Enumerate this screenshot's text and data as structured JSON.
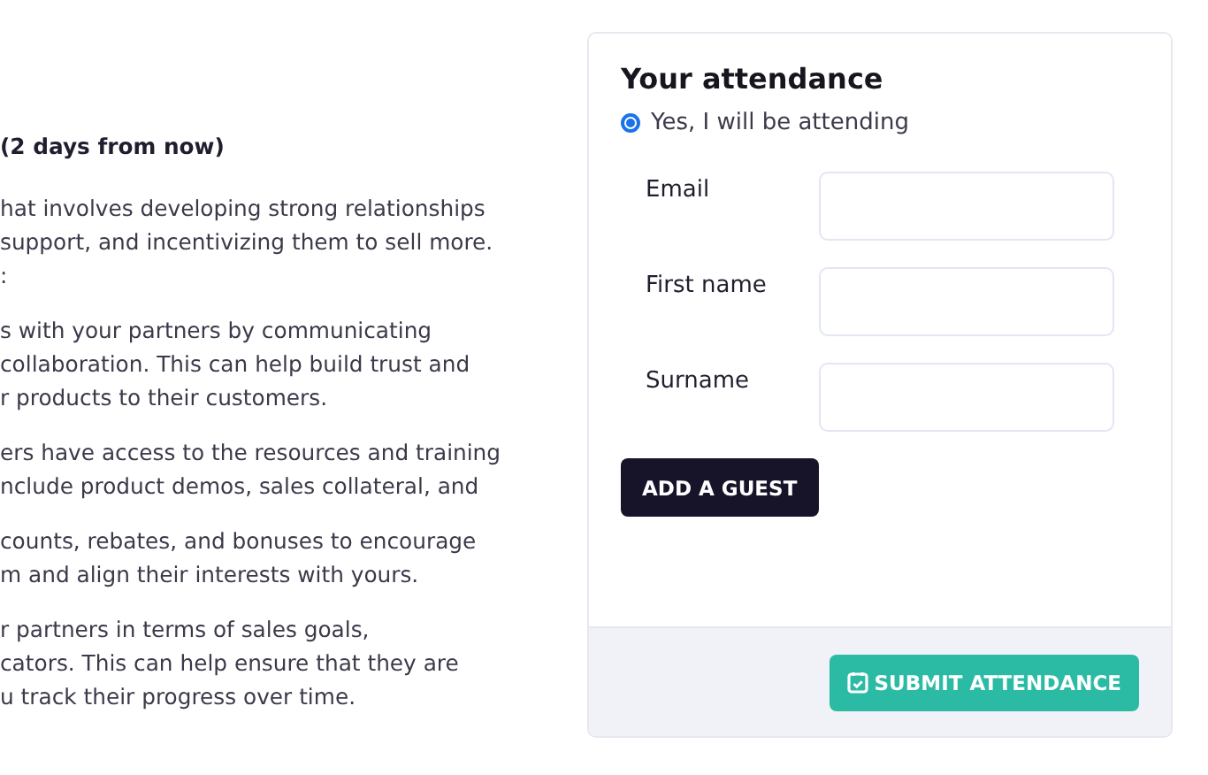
{
  "article": {
    "heading": "(2 days from now)",
    "paragraphs": [
      [
        "hat involves developing strong relationships",
        "support, and incentivizing them to sell more.",
        ":"
      ],
      [
        "s with your partners by communicating",
        "collaboration. This can help build trust and",
        "r products to their customers."
      ],
      [
        "ers have access to the resources and training",
        "nclude product demos, sales collateral, and"
      ],
      [
        "counts, rebates, and bonuses to encourage",
        "m and align their interests with yours."
      ],
      [
        "r partners in terms of sales goals,",
        "cators. This can help ensure that they are",
        "u track their progress over time."
      ]
    ]
  },
  "attendance": {
    "title": "Your attendance",
    "option": {
      "label": "Yes, I will be attending",
      "selected": true
    },
    "fields": [
      {
        "label": "Email"
      },
      {
        "label": "First name"
      },
      {
        "label": "Surname"
      }
    ],
    "add_guest": "ADD A GUEST",
    "submit": "SUBMIT ATTENDANCE"
  }
}
